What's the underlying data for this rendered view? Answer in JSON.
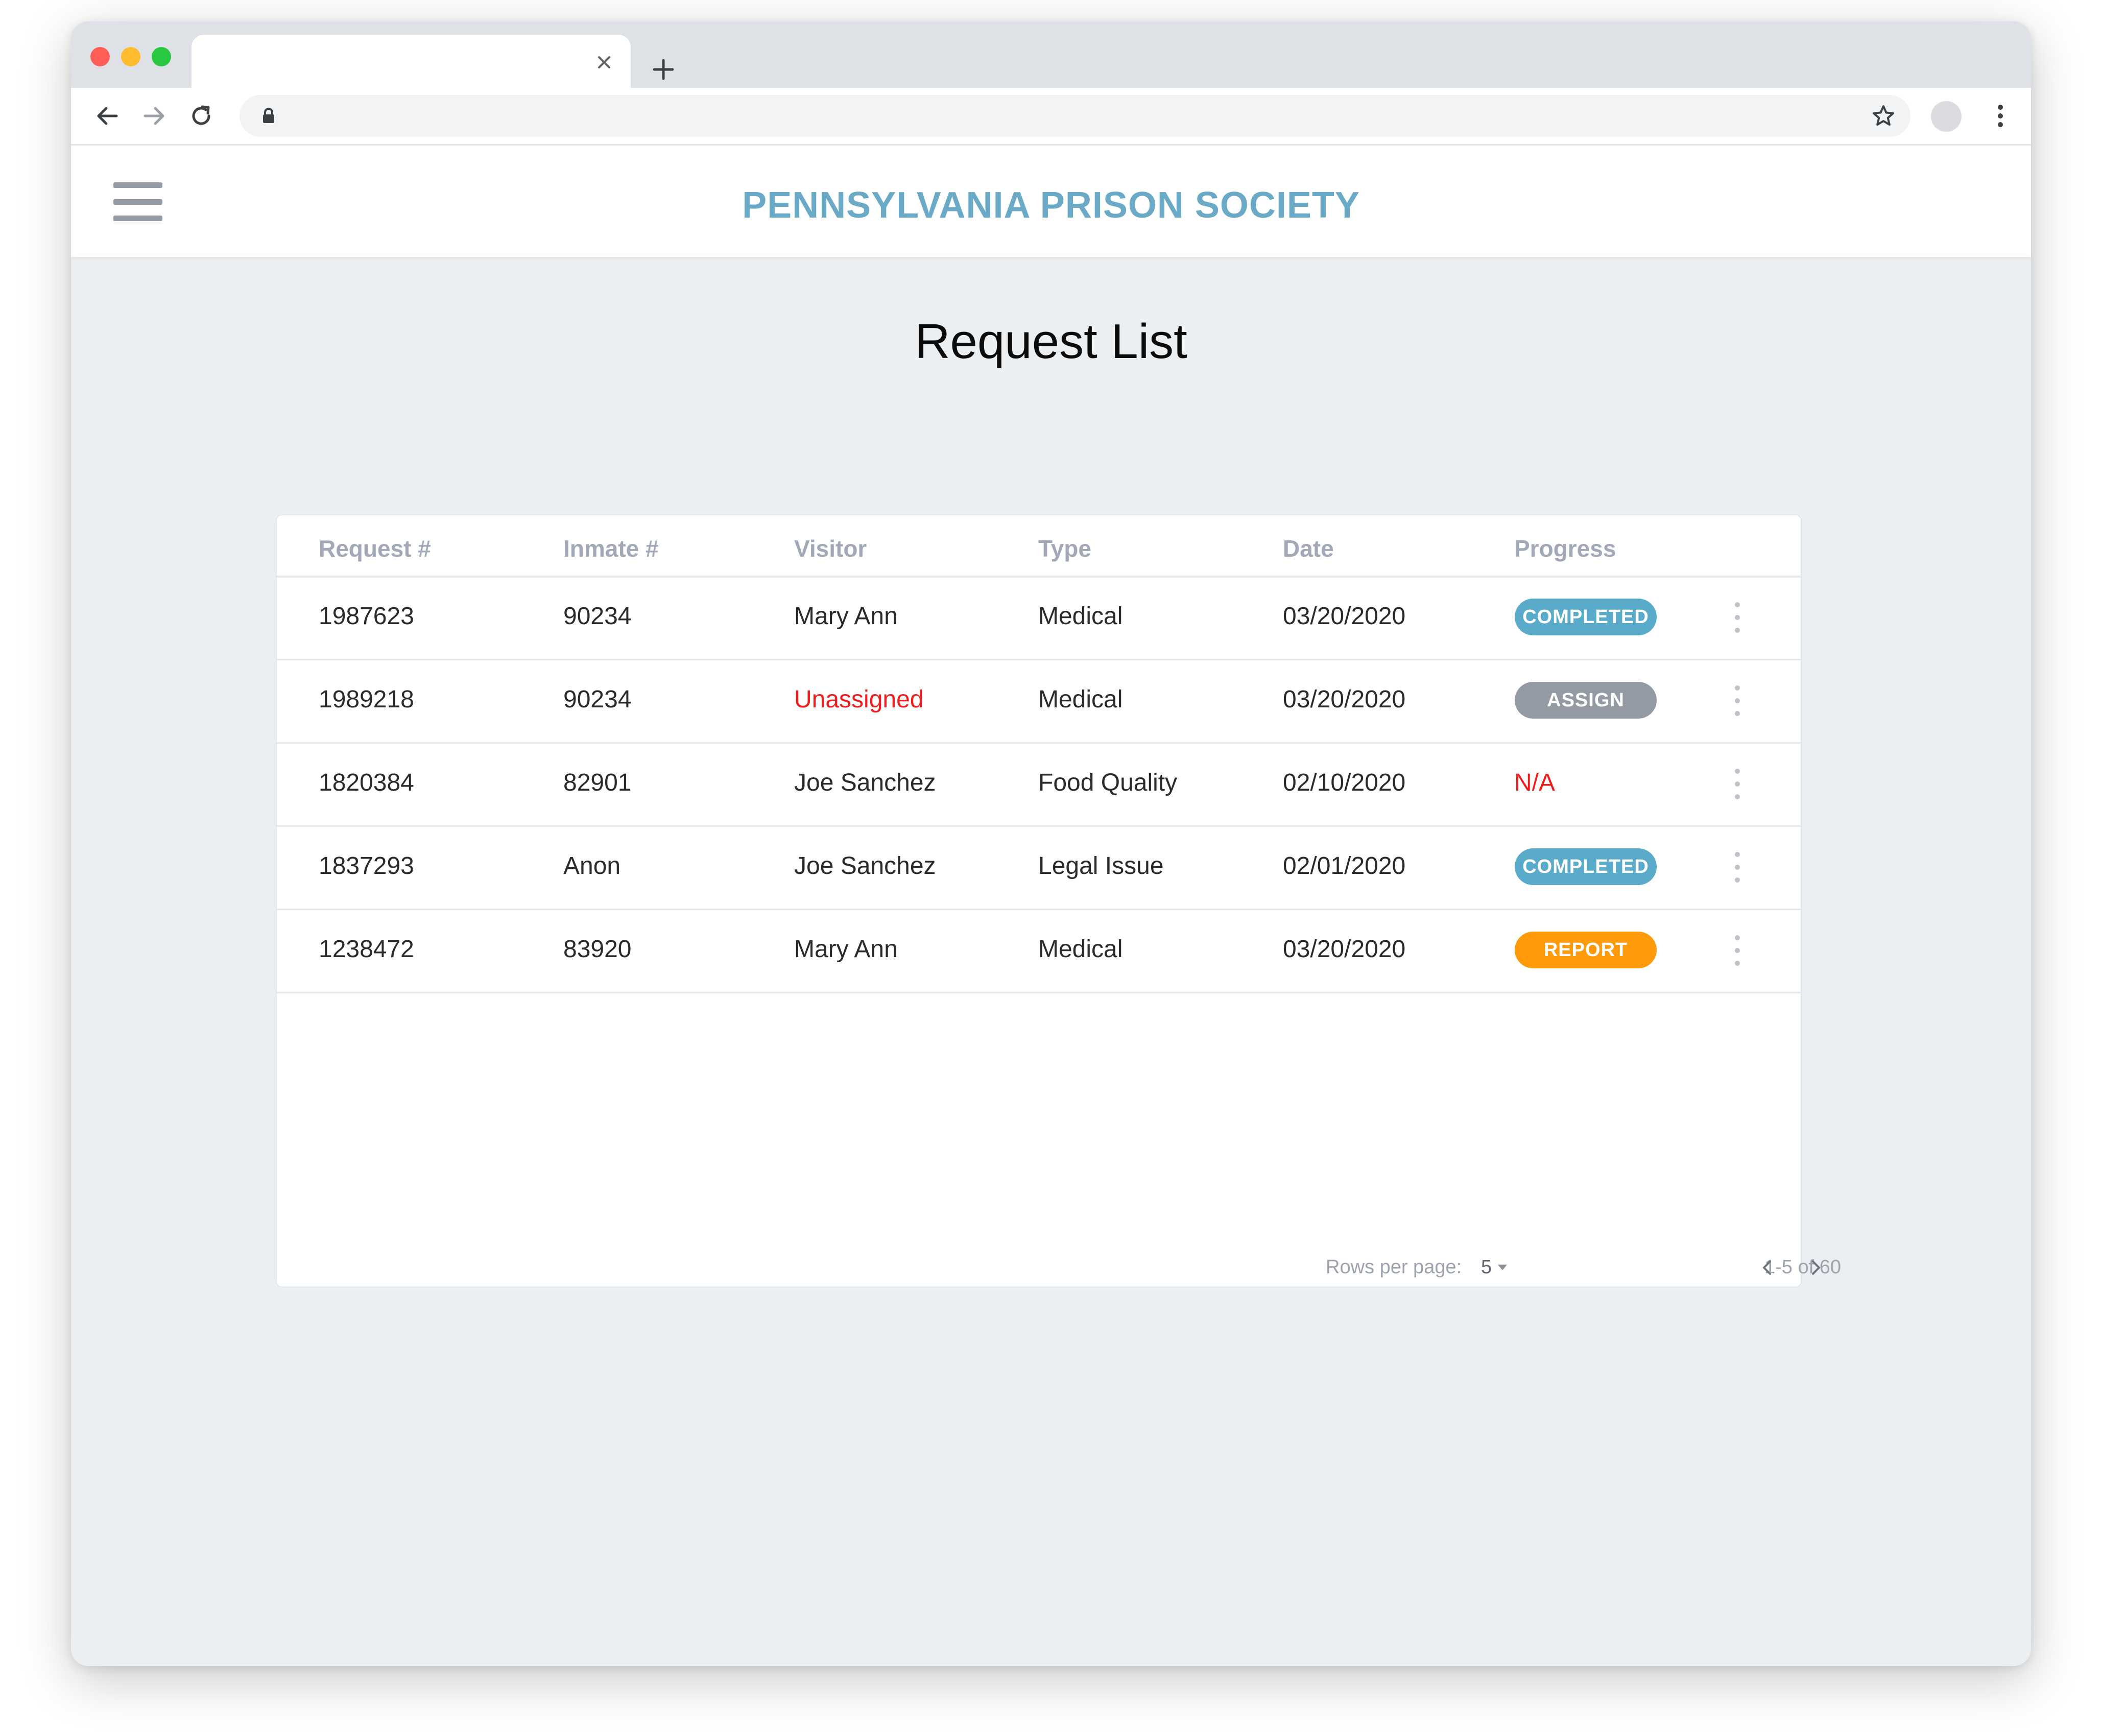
{
  "browser": {
    "tab_title": "",
    "address": ""
  },
  "header": {
    "brand": "PENNSYLVANIA PRISON SOCIETY"
  },
  "page": {
    "title": "Request List"
  },
  "table": {
    "columns": {
      "request": "Request #",
      "inmate": "Inmate #",
      "visitor": "Visitor",
      "type": "Type",
      "date": "Date",
      "progress": "Progress"
    },
    "rows": [
      {
        "request": "1987623",
        "inmate": "90234",
        "visitor": "Mary Ann",
        "type": "Medical",
        "date": "03/20/2020",
        "progress": "COMPLETED",
        "progress_kind": "badge",
        "progress_color": "#5aaac9"
      },
      {
        "request": "1989218",
        "inmate": "90234",
        "visitor": "Unassigned",
        "visitor_alert": true,
        "type": "Medical",
        "date": "03/20/2020",
        "progress": "ASSIGN",
        "progress_kind": "badge",
        "progress_color": "#949aa3"
      },
      {
        "request": "1820384",
        "inmate": "82901",
        "visitor": "Joe Sanchez",
        "type": "Food Quality",
        "date": "02/10/2020",
        "progress": "N/A",
        "progress_kind": "text",
        "progress_color": "#ee1c1c"
      },
      {
        "request": "1837293",
        "inmate": "Anon",
        "visitor": "Joe Sanchez",
        "type": "Legal Issue",
        "date": "02/01/2020",
        "progress": "COMPLETED",
        "progress_kind": "badge",
        "progress_color": "#5aaac9"
      },
      {
        "request": "1238472",
        "inmate": "83920",
        "visitor": "Mary Ann",
        "type": "Medical",
        "date": "03/20/2020",
        "progress": "REPORT",
        "progress_kind": "badge",
        "progress_color": "#ff9a0a"
      }
    ]
  },
  "pagination": {
    "rows_per_page_label": "Rows per page:",
    "rows_per_page_value": "5",
    "range_text": "1-5 of 60"
  },
  "colors": {
    "brand": "#6aaac6",
    "alert": "#ee1c1c",
    "completed": "#5aaac9",
    "assign": "#949aa3",
    "report": "#ff9a0a"
  },
  "icons": [
    "close-icon",
    "plus-icon",
    "back-arrow-icon",
    "forward-arrow-icon",
    "reload-icon",
    "lock-icon",
    "star-icon",
    "kebab-menu-icon",
    "hamburger-menu-icon",
    "chevron-left-icon",
    "chevron-right-icon",
    "dropdown-caret-icon"
  ]
}
